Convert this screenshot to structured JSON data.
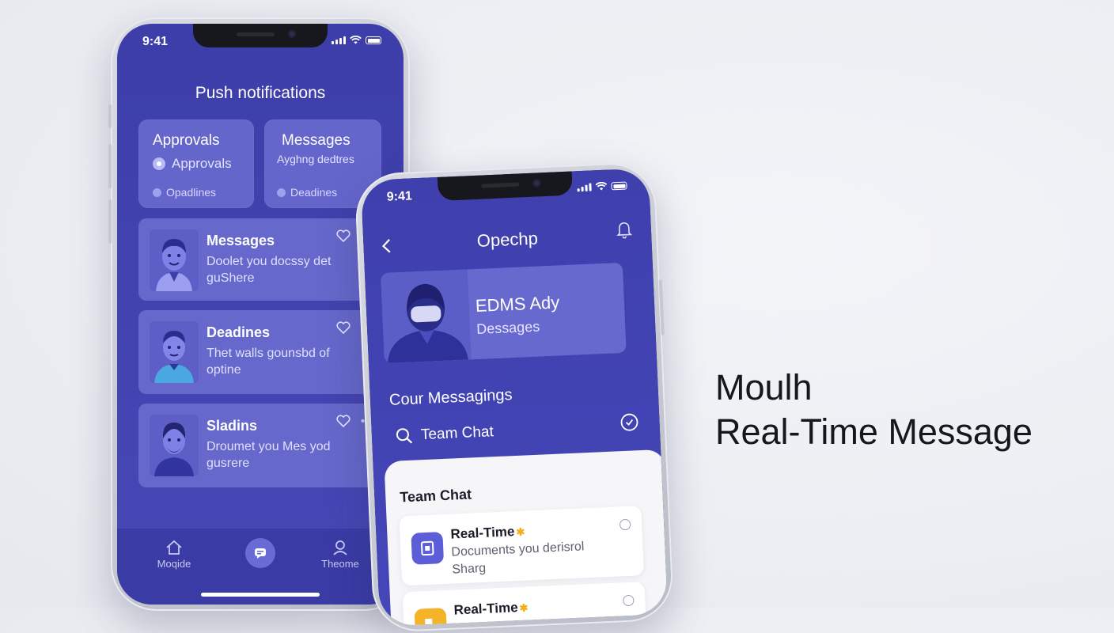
{
  "left_phone": {
    "status_time": "9:41",
    "title": "Push notifications",
    "tiles": [
      {
        "title": "Approvals",
        "subtitle": "Approvals",
        "deadline": "Opadlines"
      },
      {
        "title": "Messages",
        "subtitle": "Ayghng dedtres",
        "deadline": "Deadines"
      }
    ],
    "cards": [
      {
        "title": "Messages",
        "body_line1": "Doolet you docssy det",
        "body_line2": "guShere"
      },
      {
        "title": "Deadines",
        "body_line1": "Thet walls gounsbd of",
        "body_line2": "optine"
      },
      {
        "title": "Sladins",
        "body_line1": "Droumet you Mes yod",
        "body_line2": "gusrere"
      }
    ],
    "nav": {
      "left_label": "Moqide",
      "right_label": "Theome"
    }
  },
  "right_phone": {
    "status_time": "9:41",
    "title": "Opechp",
    "hero": {
      "title": "EDMS Ady",
      "subtitle": "Dessages"
    },
    "section_title": "Cour Messagings",
    "search_label": "Team Chat",
    "sheet_title": "Team Chat",
    "messages": [
      {
        "title": "Real-Time",
        "body_line1": "Documents you derisrol",
        "body_line2": "Sharg",
        "icon_color": "#5b5ed6"
      },
      {
        "title": "Real-Time",
        "body_line1": "",
        "body_line2": "",
        "icon_color": "#f3b42a"
      }
    ]
  },
  "headline": {
    "line1": "Moulh",
    "line2": "Real-Time Message"
  },
  "colors": {
    "brand": "#4446b8",
    "card": "#6466cc",
    "accent_yellow": "#f3b42a"
  }
}
